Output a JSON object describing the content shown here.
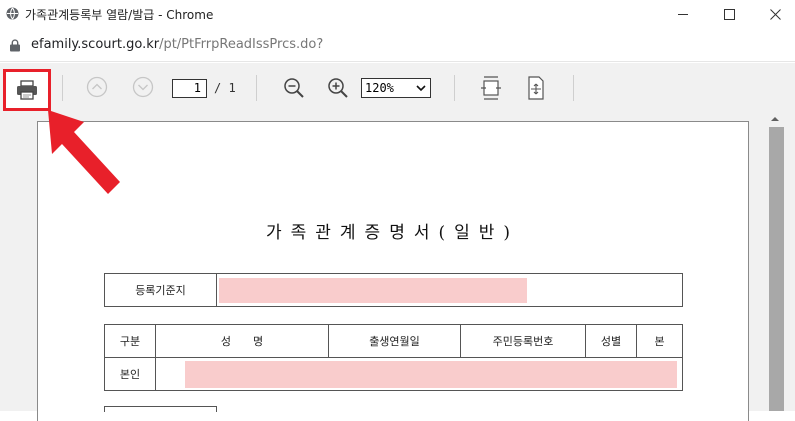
{
  "window": {
    "title": "가족관계등록부 열람/발급 - Chrome",
    "controls": [
      "minimize-icon",
      "maximize-icon",
      "close-icon"
    ]
  },
  "address": {
    "host": "efamily.scourt.go.kr",
    "path": "/pt/PtFrrpReadIssPrcs.do?"
  },
  "toolbar": {
    "icons": [
      "printer-icon",
      "prev-page-icon",
      "next-page-icon",
      "zoom-out-icon",
      "zoom-in-icon",
      "fit-width-icon",
      "fit-page-icon"
    ],
    "current_page": "1",
    "total_pages": "/ 1",
    "zoom": "120%",
    "highlight_color": "#e8202a"
  },
  "document": {
    "title": "가족관계증명서(일반)",
    "register_label": "등록기준지",
    "headers": [
      "구분",
      "성　　명",
      "출생연월일",
      "주민등록번호",
      "성별",
      "본"
    ],
    "row_label": "본인",
    "redaction_color": "#f9cccc"
  }
}
